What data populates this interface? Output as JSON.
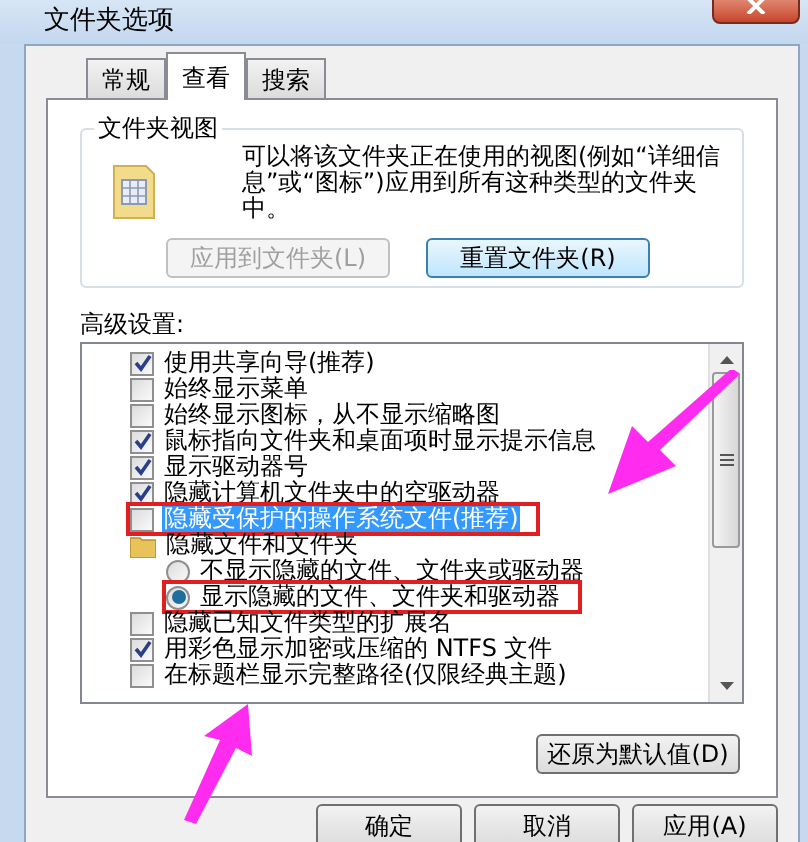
{
  "window": {
    "title": "文件夹选项"
  },
  "tabs": [
    {
      "label": "常规",
      "selected": false
    },
    {
      "label": "查看",
      "selected": true
    },
    {
      "label": "搜索",
      "selected": false
    }
  ],
  "folder_views": {
    "title": "文件夹视图",
    "description": "可以将该文件夹正在使用的视图(例如“详细信息”或“图标”)应用到所有这种类型的文件夹中。",
    "buttons": [
      {
        "label": "应用到文件夹(L)",
        "disabled": true
      },
      {
        "label": "重置文件夹(R)",
        "disabled": false
      }
    ]
  },
  "advanced": {
    "label": "高级设置:",
    "items": [
      {
        "kind": "checkbox",
        "label": "使用共享向导(推荐)",
        "checked": true,
        "selected": false,
        "marked": false
      },
      {
        "kind": "checkbox",
        "label": "始终显示菜单",
        "checked": false,
        "selected": false,
        "marked": false
      },
      {
        "kind": "checkbox",
        "label": "始终显示图标，从不显示缩略图",
        "checked": false,
        "selected": false,
        "marked": false
      },
      {
        "kind": "checkbox",
        "label": "鼠标指向文件夹和桌面项时显示提示信息",
        "checked": true,
        "selected": false,
        "marked": false
      },
      {
        "kind": "checkbox",
        "label": "显示驱动器号",
        "checked": true,
        "selected": false,
        "marked": false
      },
      {
        "kind": "checkbox",
        "label": "隐藏计算机文件夹中的空驱动器",
        "checked": true,
        "selected": false,
        "marked": false
      },
      {
        "kind": "checkbox",
        "label": "隐藏受保护的操作系统文件(推荐)",
        "checked": false,
        "selected": true,
        "marked": true
      },
      {
        "kind": "folder",
        "label": "隐藏文件和文件夹",
        "selected": false,
        "marked": false,
        "children": [
          {
            "kind": "radio",
            "label": "不显示隐藏的文件、文件夹或驱动器",
            "checked": false,
            "selected": false,
            "marked": false
          },
          {
            "kind": "radio",
            "label": "显示隐藏的文件、文件夹和驱动器",
            "checked": true,
            "selected": false,
            "marked": true
          }
        ]
      },
      {
        "kind": "checkbox",
        "label": "隐藏已知文件类型的扩展名",
        "checked": false,
        "selected": false,
        "marked": false
      },
      {
        "kind": "checkbox",
        "label": "用彩色显示加密或压缩的 NTFS 文件",
        "checked": true,
        "selected": false,
        "marked": false
      },
      {
        "kind": "checkbox",
        "label": "在标题栏显示完整路径(仅限经典主题)",
        "checked": false,
        "selected": false,
        "marked": false
      }
    ]
  },
  "restore_button": "还原为默认值(D)",
  "buttons": [
    "确定",
    "取消",
    "应用(A)"
  ]
}
